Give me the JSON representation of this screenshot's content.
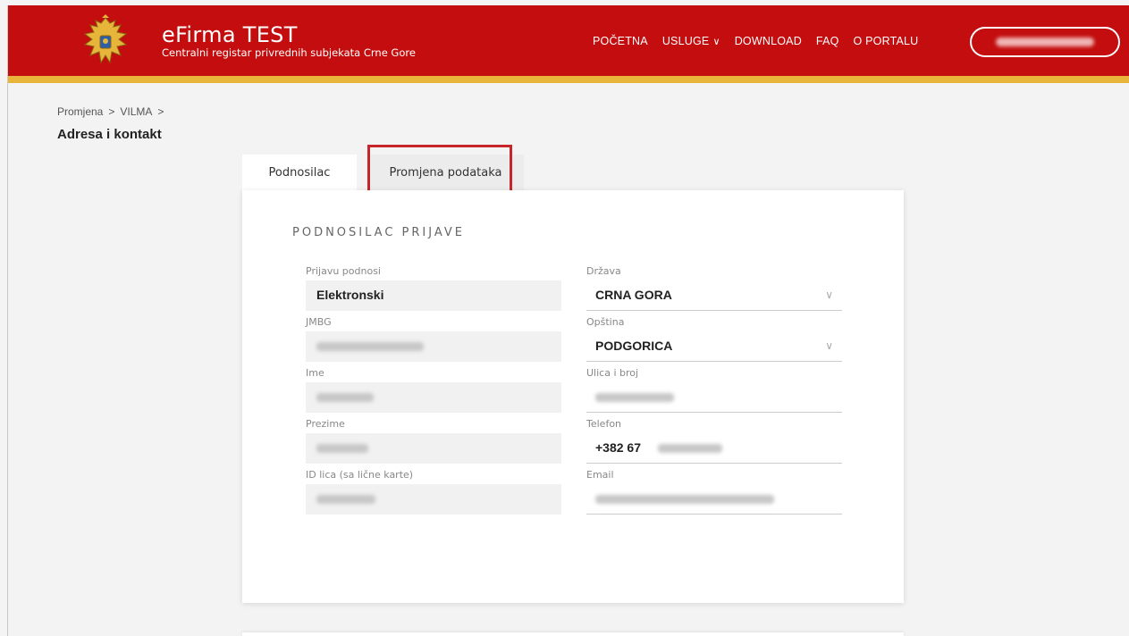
{
  "header": {
    "title": "eFirma TEST",
    "subtitle": "Centralni registar privrednih subjekata Crne Gore",
    "nav": [
      {
        "label": "POČETNA"
      },
      {
        "label": "USLUGE",
        "has_dropdown": true
      },
      {
        "label": "DOWNLOAD"
      },
      {
        "label": "FAQ"
      },
      {
        "label": "O PORTALU"
      }
    ],
    "user_menu": {
      "icon": "chevron-down-icon"
    },
    "colors": {
      "primary": "#c30d0e",
      "accent": "#e8b43a",
      "highlight": "#c8252b"
    }
  },
  "breadcrumb": {
    "items": [
      "Promjena",
      "VILMA"
    ],
    "separator": ">"
  },
  "page_title": "Adresa i kontakt",
  "tabs": [
    {
      "label": "Podnosilac",
      "active": true
    },
    {
      "label": "Promjena podataka",
      "active": false,
      "highlighted": true
    }
  ],
  "form": {
    "section_title": "PODNOSILAC PRIJAVE",
    "left": [
      {
        "label": "Prijavu podnosi",
        "value": "Elektronski"
      },
      {
        "label": "JMBG",
        "value": ""
      },
      {
        "label": "Ime",
        "value": ""
      },
      {
        "label": "Prezime",
        "value": ""
      },
      {
        "label": "ID lica (sa lične karte)",
        "value": ""
      }
    ],
    "right": [
      {
        "label": "Država",
        "value": "CRNA GORA",
        "select": true
      },
      {
        "label": "Opština",
        "value": "PODGORICA",
        "select": true
      },
      {
        "label": "Ulica i broj",
        "value": ""
      },
      {
        "label": "Telefon",
        "value": "+382 67"
      },
      {
        "label": "Email",
        "value": ""
      }
    ]
  }
}
